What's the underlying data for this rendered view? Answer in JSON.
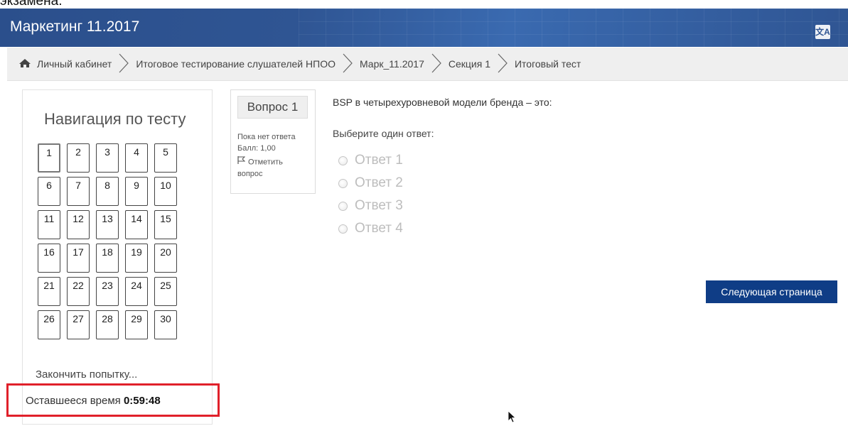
{
  "top_caption": "экзамена.",
  "header": {
    "title": "Маркетинг 11.2017",
    "translate_icon": "translate-icon"
  },
  "breadcrumb": {
    "home_icon": "home-icon",
    "items": [
      "Личный кабинет",
      "Итоговое тестирование слушателей НПОО",
      "Марк_11.2017",
      "Секция 1",
      "Итоговый тест"
    ]
  },
  "quiz_nav": {
    "title": "Навигация по тесту",
    "questions": [
      "1",
      "2",
      "3",
      "4",
      "5",
      "6",
      "7",
      "8",
      "9",
      "10",
      "11",
      "12",
      "13",
      "14",
      "15",
      "16",
      "17",
      "18",
      "19",
      "20",
      "21",
      "22",
      "23",
      "24",
      "25",
      "26",
      "27",
      "28",
      "29",
      "30"
    ],
    "current": "1",
    "finish_link": "Закончить попытку...",
    "timer_label": "Оставшееся время",
    "timer_value": "0:59:48"
  },
  "question": {
    "number_label": "Вопрос 1",
    "status": "Пока нет ответа",
    "score": "Балл: 1,00",
    "flag_label": "Отметить вопрос",
    "text": "BSP в четырехуровневой модели бренда – это:",
    "prompt": "Выберите один ответ:",
    "answers": [
      "Ответ 1",
      "Ответ 2",
      "Ответ 3",
      "Ответ 4"
    ]
  },
  "next_button": "Следующая страница",
  "colors": {
    "header": "#2f5593",
    "button": "#0f3d86",
    "highlight": "#e0202a"
  }
}
